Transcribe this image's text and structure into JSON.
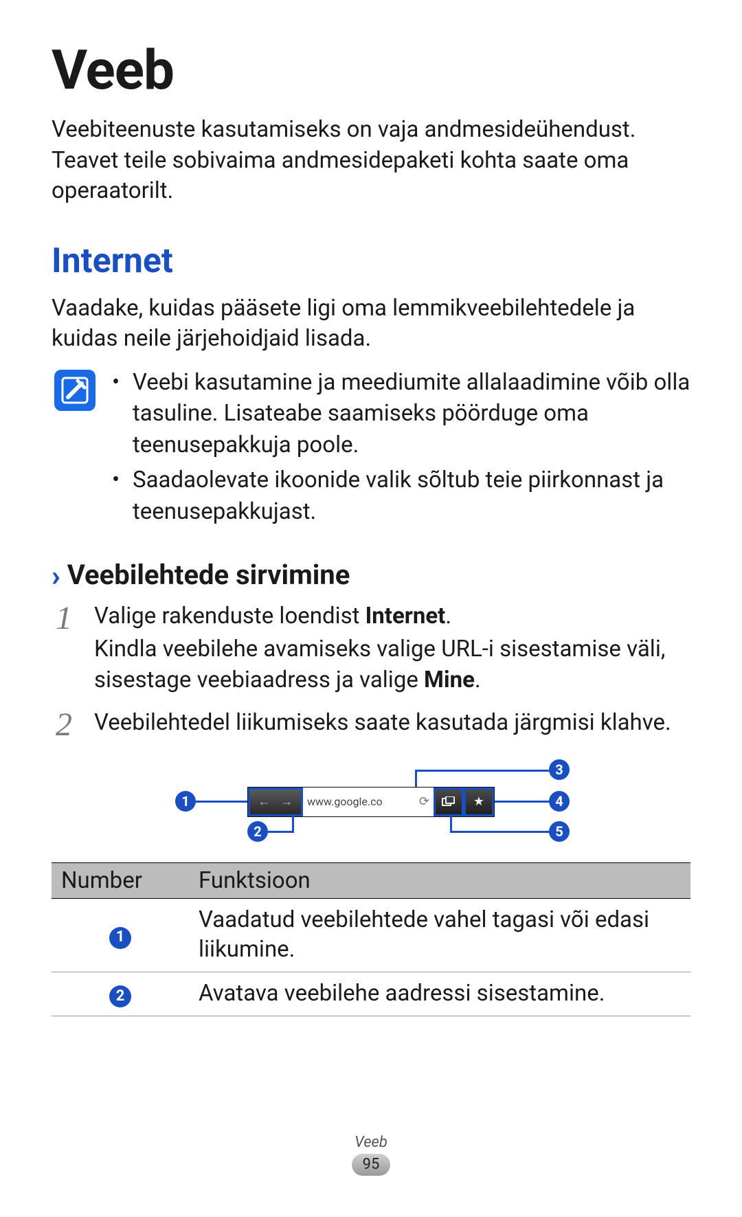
{
  "title": "Veeb",
  "intro": "Veebiteenuste kasutamiseks on vaja andmesideühendust. Teavet teile sobivaima andmesidepaketi kohta saate oma operaatorilt.",
  "section_heading": "Internet",
  "section_intro": "Vaadake, kuidas pääsete ligi oma lemmikveebilehtedele ja kuidas neile järjehoidjaid lisada.",
  "notes": [
    "Veebi kasutamine ja meediumite allalaadimine võib olla tasuline. Lisateabe saamiseks pöörduge oma teenusepakkuja poole.",
    "Saadaolevate ikoonide valik sõltub teie piirkonnast ja teenusepakkujast."
  ],
  "subheading": "Veebilehtede sirvimine",
  "steps": [
    {
      "num": "1",
      "line_a": "Valige rakenduste loendist ",
      "bold_a": "Internet",
      "after_a": ".",
      "line_b": "Kindla veebilehe avamiseks valige URL-i sisestamise väli, sisestage veebiaadress ja valige ",
      "bold_b": "Mine",
      "after_b": "."
    },
    {
      "num": "2",
      "line_a": "Veebilehtedel liikumiseks saate kasutada järgmisi klahve.",
      "bold_a": "",
      "after_a": "",
      "line_b": "",
      "bold_b": "",
      "after_b": ""
    }
  ],
  "diagram": {
    "url_text": "www.google.co",
    "callouts": {
      "c1": "1",
      "c2": "2",
      "c3": "3",
      "c4": "4",
      "c5": "5"
    }
  },
  "table": {
    "headers": {
      "num": "Number",
      "func": "Funktsioon"
    },
    "rows": [
      {
        "n": "1",
        "desc": "Vaadatud veebilehtede vahel tagasi või edasi liikumine."
      },
      {
        "n": "2",
        "desc": "Avatava veebilehe aadressi sisestamine."
      }
    ]
  },
  "footer": {
    "title": "Veeb",
    "page": "95"
  }
}
